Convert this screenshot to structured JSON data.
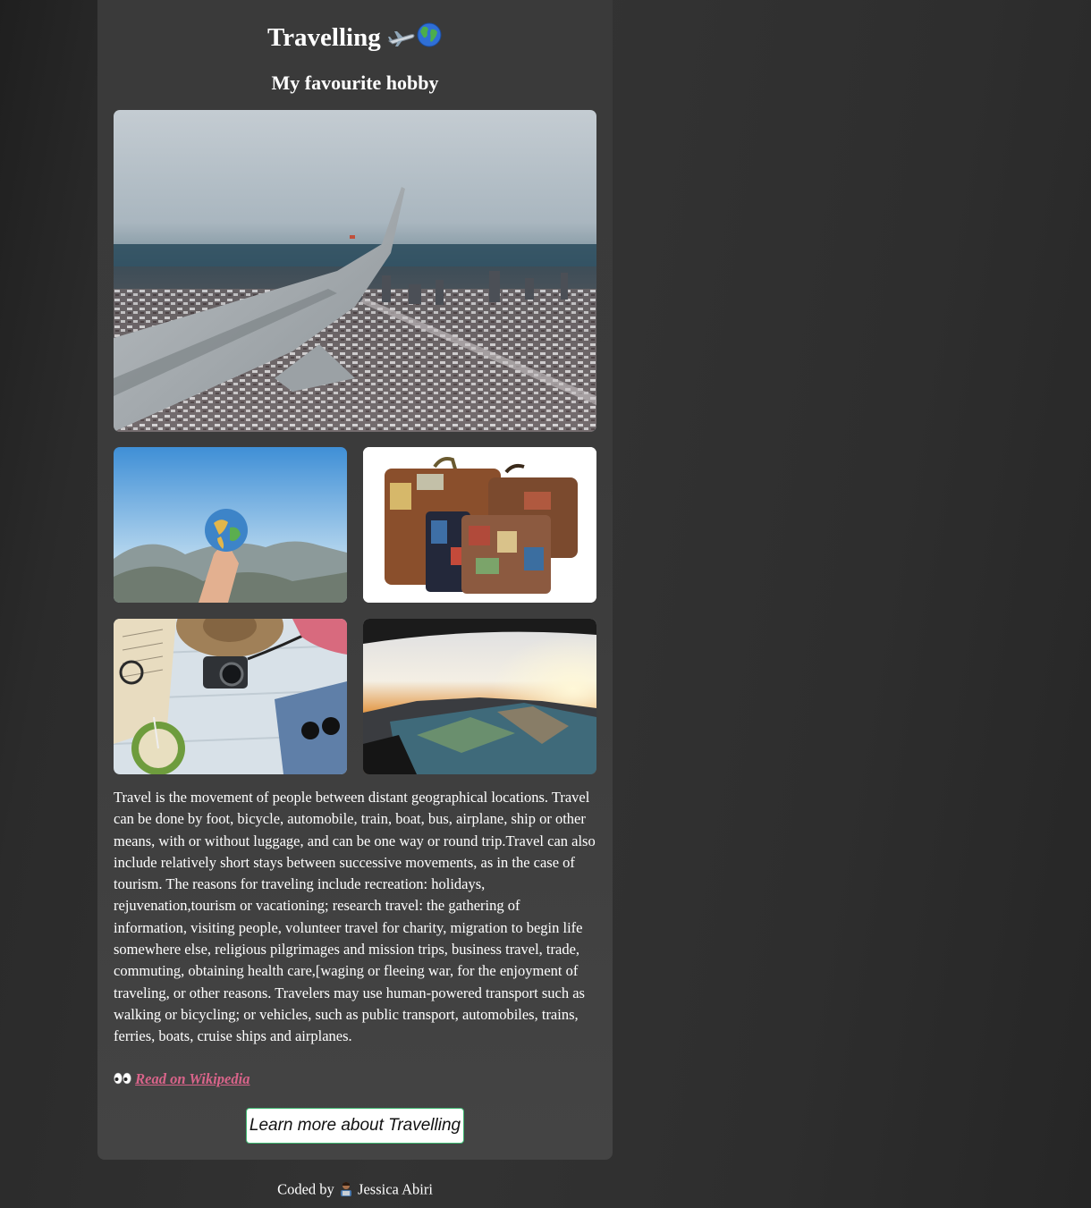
{
  "header": {
    "title": "Travelling",
    "title_icons": [
      "airplane-icon",
      "globe-icon"
    ],
    "subtitle": "My favourite hobby"
  },
  "images": {
    "hero": "airplane-wing-over-city",
    "gallery": [
      "hand-holding-globe",
      "vintage-suitcases",
      "travel-flatlay",
      "car-dashboard-map-sunset"
    ]
  },
  "description": "Travel is the movement of people between distant geographical locations. Travel can be done by foot, bicycle, automobile, train, boat, bus, airplane, ship or other means, with or without luggage, and can be one way or round trip.Travel can also include relatively short stays between successive movements, as in the case of tourism. The reasons for traveling include recreation: holidays, rejuvenation,tourism or vacationing; research travel: the gathering of information, visiting people, volunteer travel for charity, migration to begin life somewhere else, religious pilgrimages and mission trips, business travel, trade, commuting, obtaining health care,[waging or fleeing war, for the enjoyment of traveling, or other reasons. Travelers may use human-powered transport such as walking or bicycling; or vehicles, such as public transport, automobiles, trains, ferries, boats, cruise ships and airplanes.",
  "wiki": {
    "icon": "eyes-icon",
    "link_text": "Read on Wikipedia"
  },
  "cta": {
    "label": "Learn more about Travelling"
  },
  "footer": {
    "prefix": "Coded by",
    "icon": "technologist-icon",
    "author": "Jessica Abiri"
  },
  "colors": {
    "link": "#d9648a",
    "button_border": "#3fb972",
    "card_bg": "#3b3b3b"
  }
}
